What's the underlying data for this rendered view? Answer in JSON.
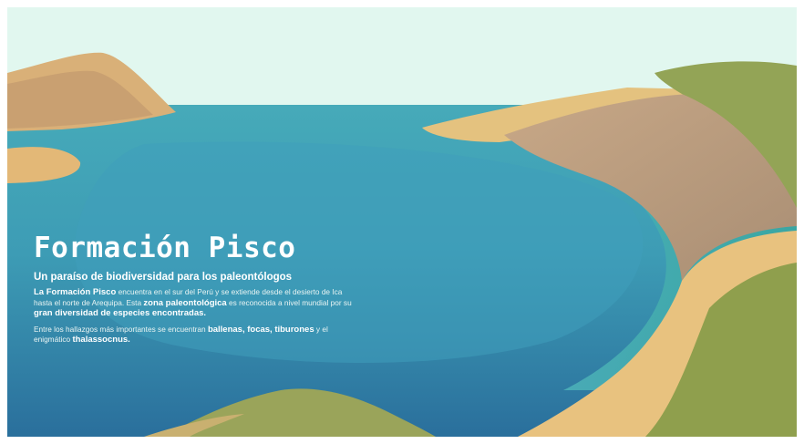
{
  "scene": {
    "description_icon": "lagoon-landscape-illustration",
    "colors": {
      "sky": "#e1f7ef",
      "water_light": "#4fb5bf",
      "water_dark": "#2c7ba4",
      "sand": "#e6c07f",
      "cliff": "#bb9b7f",
      "grass": "#8e9f4f"
    }
  },
  "hero": {
    "title": "Formación Pisco",
    "subtitle": "Un paraíso de biodiversidad para los paleontólogos",
    "p1": [
      {
        "t": "La Formación Pisco",
        "b": true
      },
      {
        "t": " encuentra en el sur del Perú y se extiende desde el desierto de Ica hasta el norte de Arequipa. Esta ",
        "b": false
      },
      {
        "t": "zona paleontológica",
        "b": true
      },
      {
        "t": " es reconocida a nivel mundial por su ",
        "b": false
      },
      {
        "t": "gran diversidad de especies encontradas.",
        "b": true
      }
    ],
    "p2": [
      {
        "t": "Entre los hallazgos más importantes se encuentran ",
        "b": false
      },
      {
        "t": "ballenas, focas, tiburones",
        "b": true
      },
      {
        "t": " y el enigmático ",
        "b": false
      },
      {
        "t": "thalassocnus.",
        "b": true
      }
    ]
  }
}
